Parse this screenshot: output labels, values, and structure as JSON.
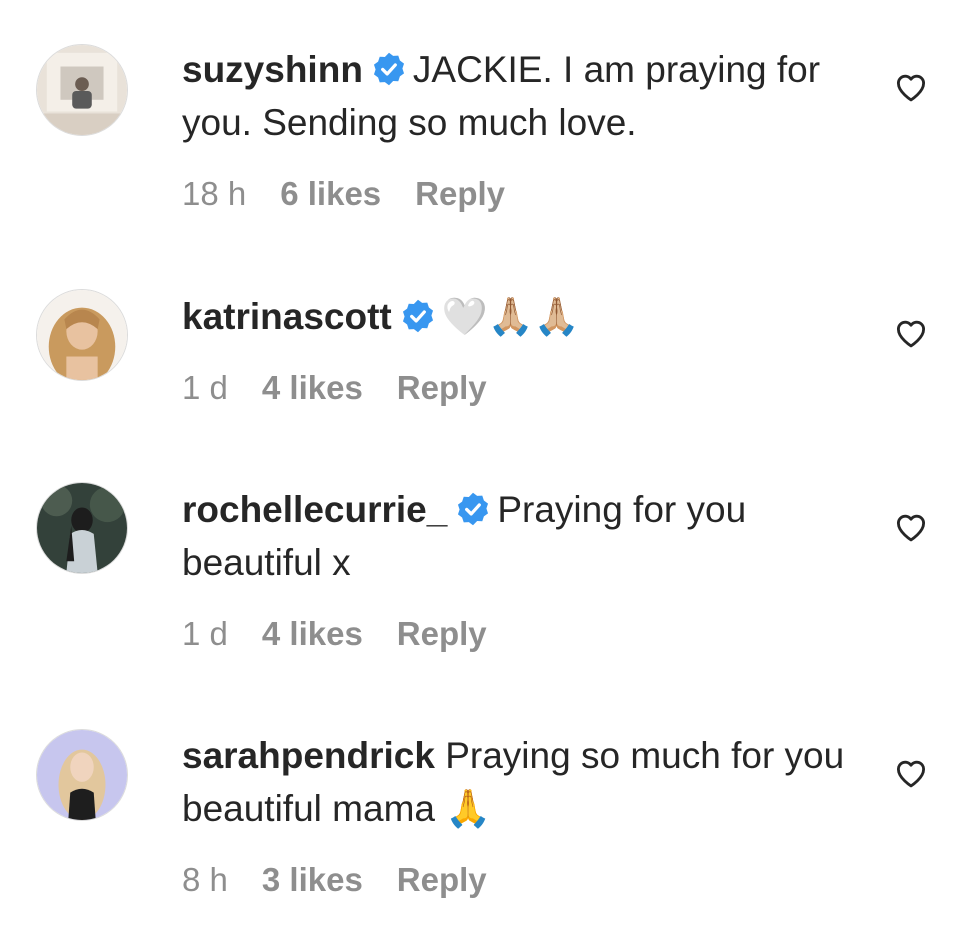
{
  "comments": [
    {
      "username": "suzyshinn",
      "verified": true,
      "text": "JACKIE. I am praying for you. Sending so much love.",
      "time": "18 h",
      "likes": "6 likes",
      "reply": "Reply"
    },
    {
      "username": "katrinascott",
      "verified": true,
      "text": "🤍🙏🏼🙏🏼",
      "time": "1 d",
      "likes": "4 likes",
      "reply": "Reply"
    },
    {
      "username": "rochellecurrie_",
      "verified": true,
      "text": "Praying for you beautiful x",
      "time": "1 d",
      "likes": "4 likes",
      "reply": "Reply"
    },
    {
      "username": "sarahpendrick",
      "verified": false,
      "text": "Praying so much for you beautiful mama 🙏",
      "time": "8 h",
      "likes": "3 likes",
      "reply": "Reply"
    }
  ],
  "colors": {
    "verified_badge": "#3897f0",
    "meta_text": "#8e8e8e",
    "primary_text": "#262626"
  },
  "icons": {
    "verified": "verified-badge-icon",
    "like": "heart-outline-icon"
  }
}
